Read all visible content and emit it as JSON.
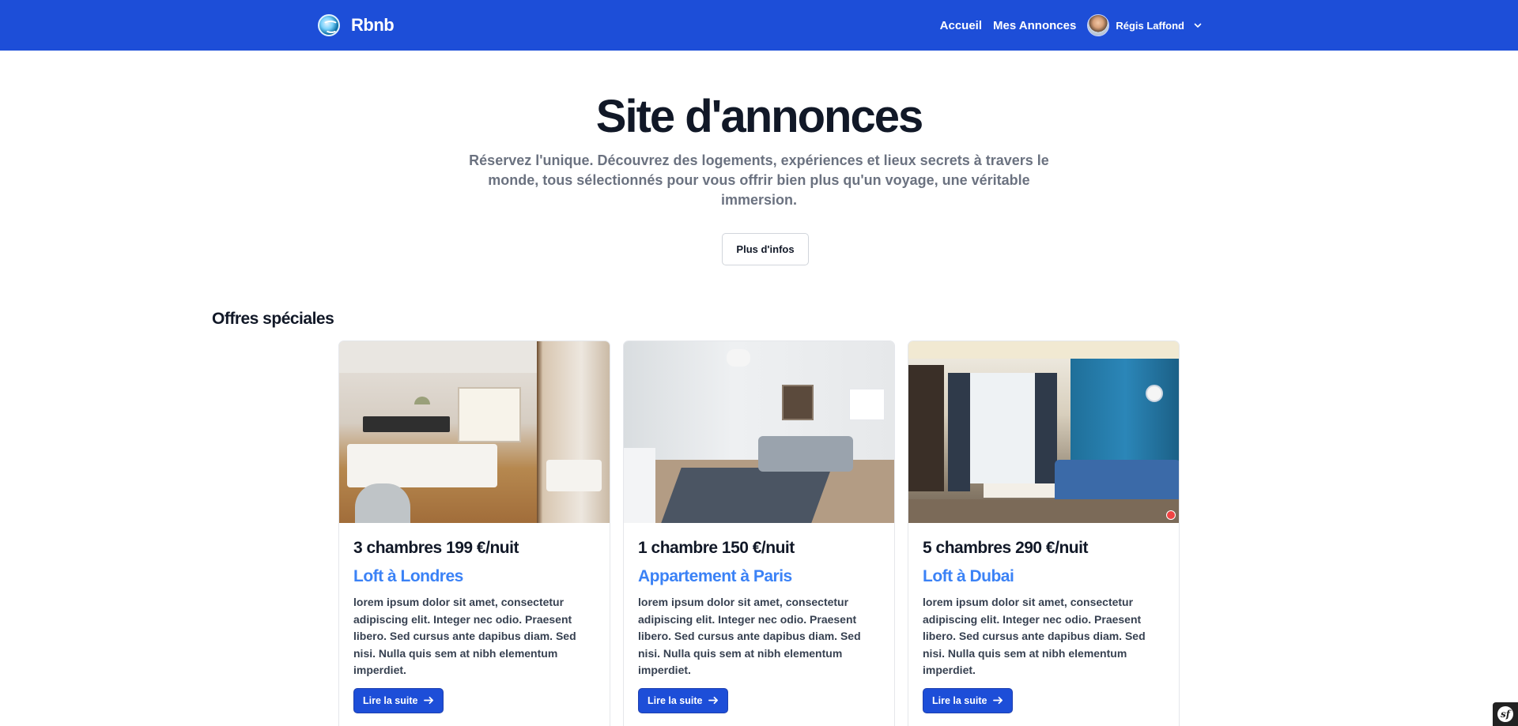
{
  "nav": {
    "brand": "Rbnb",
    "links": [
      "Accueil",
      "Mes Annonces"
    ],
    "user_name": "Régis Laffond"
  },
  "hero": {
    "title": "Site d'annonces",
    "subtitle": "Réservez l'unique. Découvrez des logements, expériences et lieux secrets à travers le monde, tous sélectionnés pour vous offrir bien plus qu'un voyage, une véritable immersion.",
    "button": "Plus d'infos"
  },
  "section": {
    "title": "Offres spéciales"
  },
  "cards": [
    {
      "title": "3 chambres 199 €/nuit",
      "subtitle": "Loft à Londres",
      "text": "lorem ipsum dolor sit amet, consectetur adipiscing elit. Integer nec odio. Praesent libero. Sed cursus ante dapibus diam. Sed nisi. Nulla quis sem at nibh elementum imperdiet.",
      "button": "Lire la suite"
    },
    {
      "title": "1 chambre 150 €/nuit",
      "subtitle": "Appartement à Paris",
      "text": "lorem ipsum dolor sit amet, consectetur adipiscing elit. Integer nec odio. Praesent libero. Sed cursus ante dapibus diam. Sed nisi. Nulla quis sem at nibh elementum imperdiet.",
      "button": "Lire la suite"
    },
    {
      "title": "5 chambres 290 €/nuit",
      "subtitle": "Loft à Dubai",
      "text": "lorem ipsum dolor sit amet, consectetur adipiscing elit. Integer nec odio. Praesent libero. Sed cursus ante dapibus diam. Sed nisi. Nulla quis sem at nibh elementum imperdiet.",
      "button": "Lire la suite"
    }
  ],
  "colors": {
    "navbar": "#1d4ed8",
    "accent": "#3b82f6",
    "button": "#1d4ed8",
    "heading": "#111827",
    "muted": "#6b7280"
  },
  "icons": {
    "brand": "globe-logo-icon",
    "user_menu": "chevron-down-icon",
    "card_button": "arrow-right-icon",
    "debug_toolbar": "symfony-icon"
  }
}
